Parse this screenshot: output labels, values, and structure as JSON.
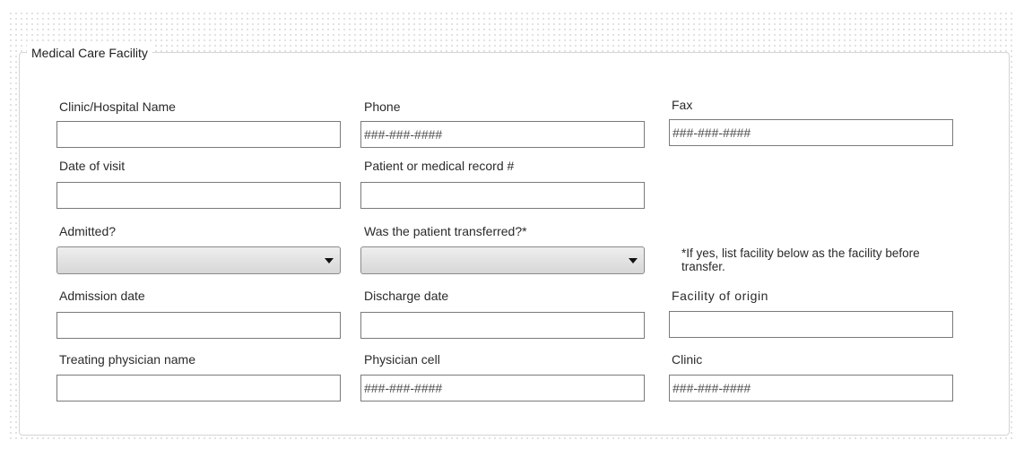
{
  "form": {
    "group_title": "Medical Care Facility",
    "placeholder_phone_mask": "###-###-####",
    "note_transfer": "*If yes, list facility below as the facility before transfer."
  },
  "labels": {
    "clinic_hospital_name": "Clinic/Hospital Name",
    "phone": "Phone",
    "fax": "Fax",
    "date_of_visit": "Date of visit",
    "patient_record": "Patient or medical record #",
    "admitted": "Admitted?",
    "transferred": "Was the patient transferred?*",
    "admission_date": "Admission date",
    "discharge_date": "Discharge date",
    "facility_of_origin": "Facility of origin",
    "treating_physician": "Treating physician name",
    "physician_cell": "Physician cell",
    "clinic": "Clinic"
  },
  "values": {
    "clinic_hospital_name": "",
    "phone": "###-###-####",
    "fax": "###-###-####",
    "date_of_visit": "",
    "patient_record": "",
    "admitted": "",
    "transferred": "",
    "admission_date": "",
    "discharge_date": "",
    "facility_of_origin": "",
    "treating_physician": "",
    "physician_cell": "###-###-####",
    "clinic": "###-###-####"
  },
  "icons": {
    "dropdown_arrow": "chevron-down-icon"
  },
  "colors": {
    "border": "#7a7a7a",
    "groupbox_border": "#d4d4d4",
    "dropdown_gradient_top": "#eeeeee",
    "dropdown_gradient_bottom": "#d7d7d7"
  }
}
